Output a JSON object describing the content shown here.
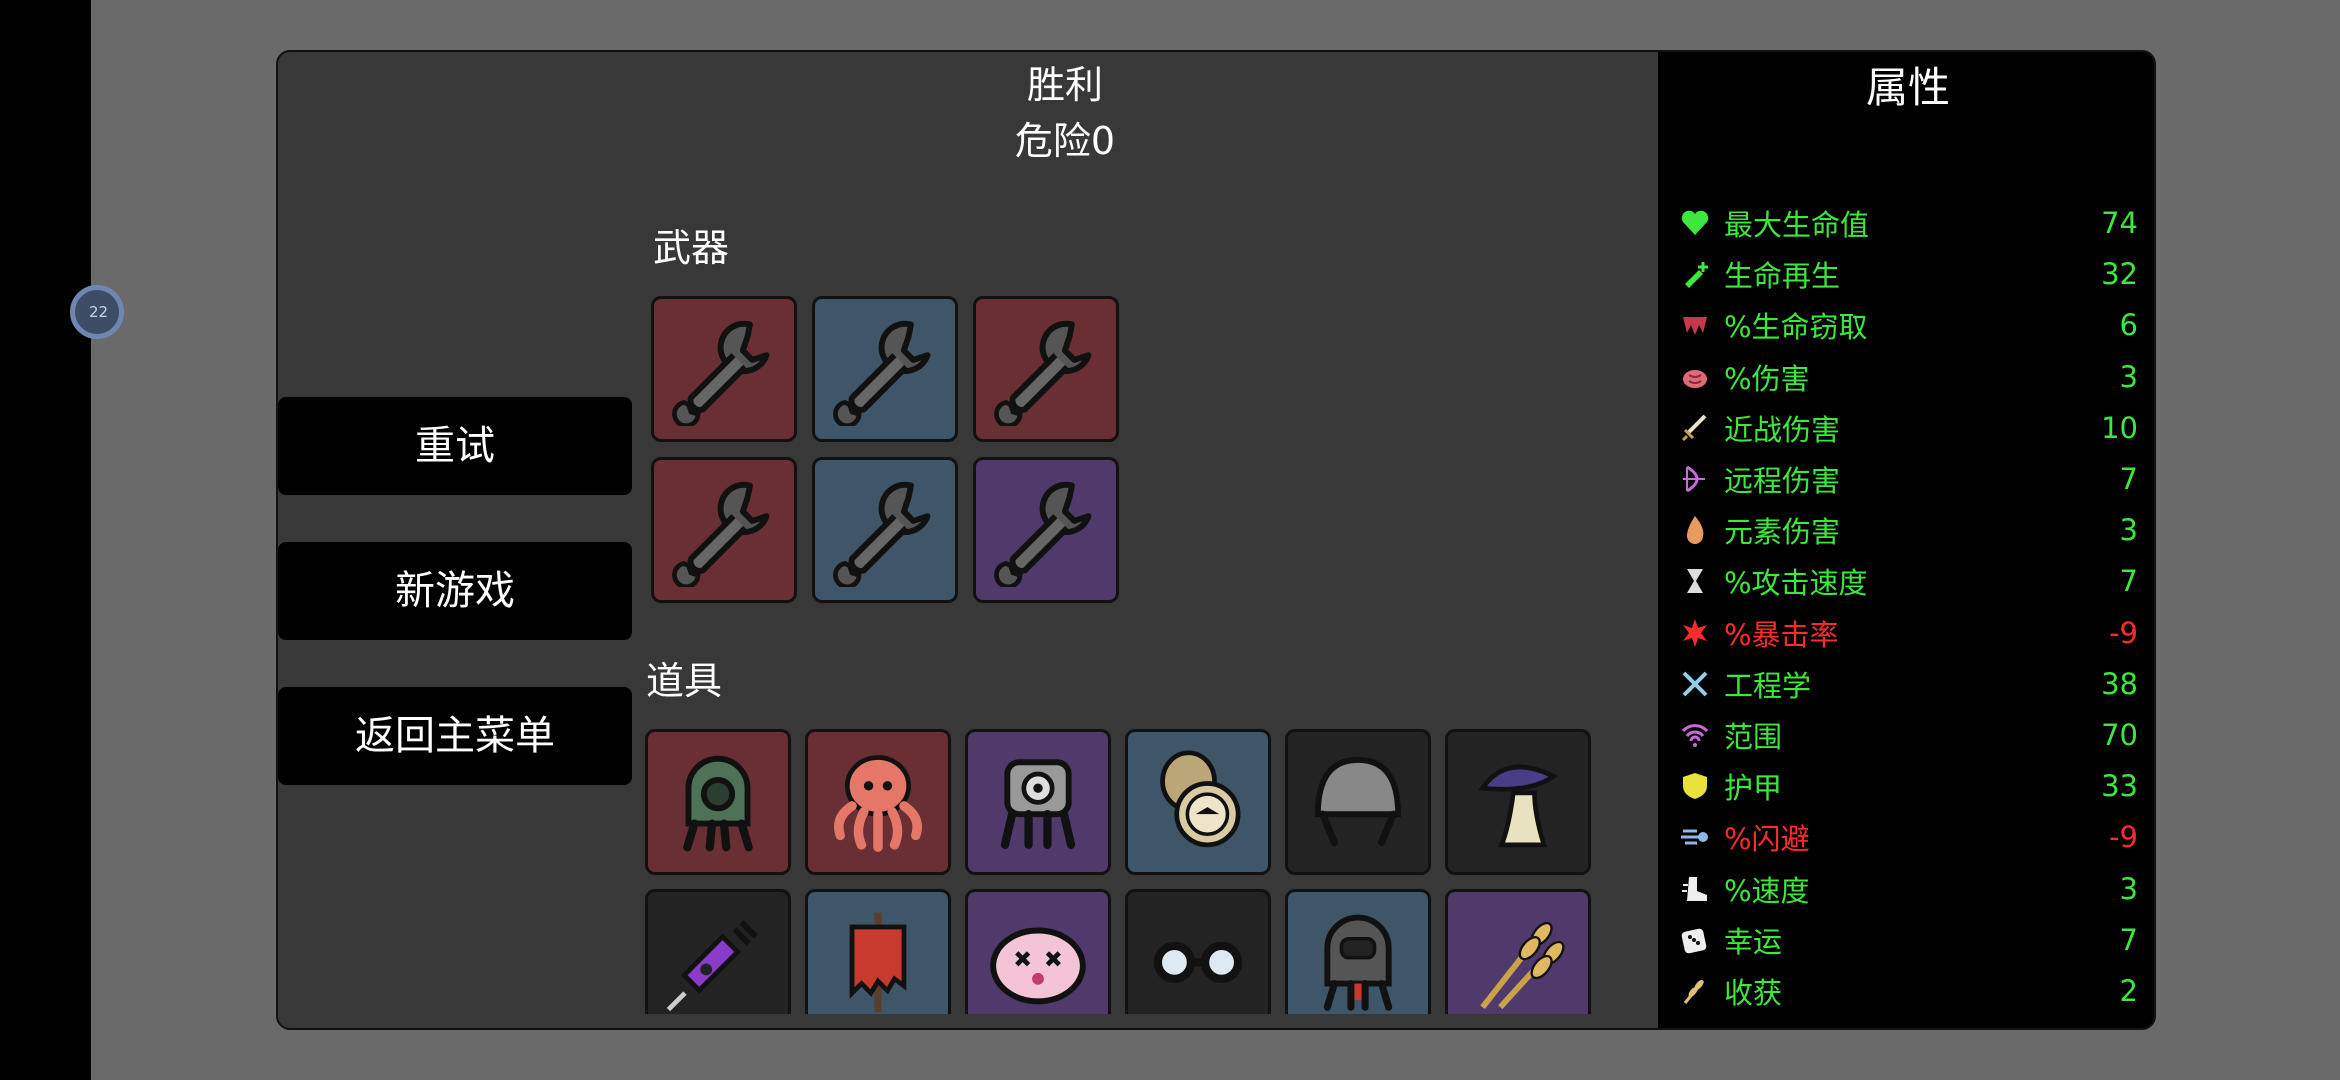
{
  "float_ball": {
    "text": "22"
  },
  "header": {
    "result": "胜利",
    "danger": "危险0"
  },
  "menu": {
    "retry": "重试",
    "new_game": "新游戏",
    "main_menu": "返回主菜单"
  },
  "sections": {
    "weapons": "武器",
    "items": "道具"
  },
  "weapons": [
    {
      "icon": "wrench-icon",
      "tier_color": "#6a2f34"
    },
    {
      "icon": "wrench-icon",
      "tier_color": "#3f5568"
    },
    {
      "icon": "wrench-icon",
      "tier_color": "#6a2f34"
    },
    {
      "icon": "wrench-icon",
      "tier_color": "#6a2f34"
    },
    {
      "icon": "wrench-icon",
      "tier_color": "#3f5568"
    },
    {
      "icon": "wrench-icon",
      "tier_color": "#4f3a6b"
    }
  ],
  "items": [
    {
      "icon": "turret-icon",
      "tier_color": "#6a2f34"
    },
    {
      "icon": "octopus-icon",
      "tier_color": "#6a2f34"
    },
    {
      "icon": "robot-turret-icon",
      "tier_color": "#4f3a6b"
    },
    {
      "icon": "compass-icon",
      "tier_color": "#3f5568"
    },
    {
      "icon": "helmet-icon",
      "tier_color": "#232323"
    },
    {
      "icon": "mushroom-icon",
      "tier_color": "#232323"
    },
    {
      "icon": "syringe-icon",
      "tier_color": "#232323"
    },
    {
      "icon": "banner-icon",
      "tier_color": "#3f5568"
    },
    {
      "icon": "blob-icon",
      "tier_color": "#4f3a6b"
    },
    {
      "icon": "glasses-icon",
      "tier_color": "#232323"
    },
    {
      "icon": "diving-helmet-icon",
      "tier_color": "#3f5568"
    },
    {
      "icon": "wheat-icon",
      "tier_color": "#4f3a6b"
    }
  ],
  "stats": {
    "title": "属性",
    "rows": [
      {
        "icon": "heart-icon",
        "label": "最大生命值",
        "value": "74",
        "positive": true
      },
      {
        "icon": "regen-icon",
        "label": "生命再生",
        "value": "32",
        "positive": true
      },
      {
        "icon": "fang-icon",
        "label": "%生命窃取",
        "value": "6",
        "positive": true
      },
      {
        "icon": "brain-icon",
        "label": "%伤害",
        "value": "3",
        "positive": true
      },
      {
        "icon": "sword-icon",
        "label": "近战伤害",
        "value": "10",
        "positive": true
      },
      {
        "icon": "bow-icon",
        "label": "远程伤害",
        "value": "7",
        "positive": true
      },
      {
        "icon": "flame-icon",
        "label": "元素伤害",
        "value": "3",
        "positive": true
      },
      {
        "icon": "hourglass-icon",
        "label": "%攻击速度",
        "value": "7",
        "positive": true
      },
      {
        "icon": "crit-icon",
        "label": "%暴击率",
        "value": "-9",
        "positive": false
      },
      {
        "icon": "tools-icon",
        "label": "工程学",
        "value": "38",
        "positive": true
      },
      {
        "icon": "range-icon",
        "label": "范围",
        "value": "70",
        "positive": true
      },
      {
        "icon": "shield-icon",
        "label": "护甲",
        "value": "33",
        "positive": true
      },
      {
        "icon": "dodge-icon",
        "label": "%闪避",
        "value": "-9",
        "positive": false
      },
      {
        "icon": "boot-icon",
        "label": "%速度",
        "value": "3",
        "positive": true
      },
      {
        "icon": "dice-icon",
        "label": "幸运",
        "value": "7",
        "positive": true
      },
      {
        "icon": "harvest-icon",
        "label": "收获",
        "value": "2",
        "positive": true
      }
    ]
  }
}
